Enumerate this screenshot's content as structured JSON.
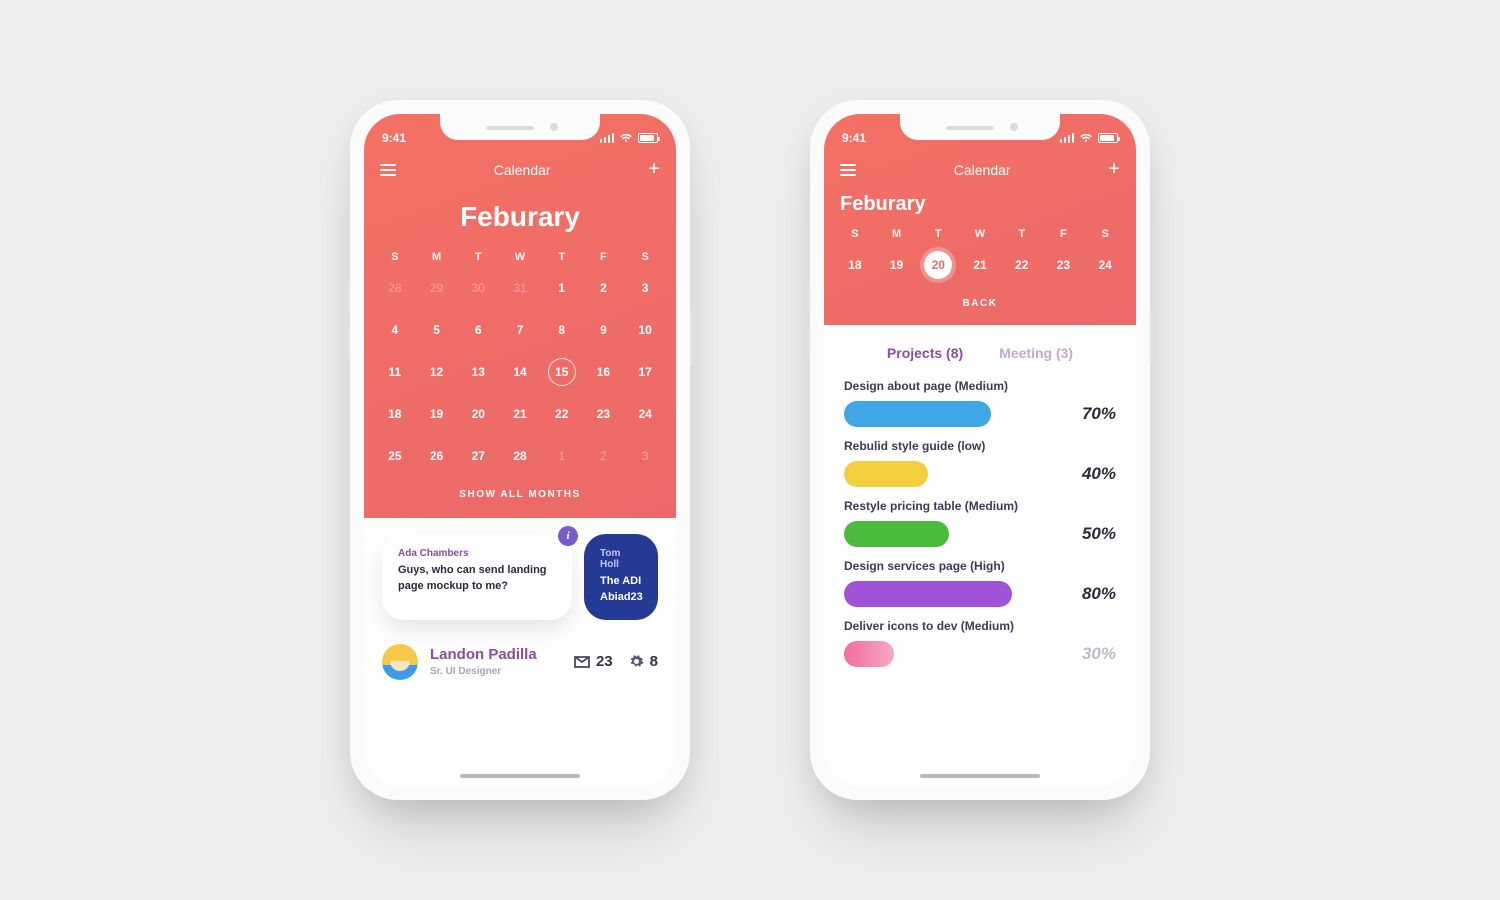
{
  "status": {
    "time": "9:41"
  },
  "header": {
    "title": "Calendar",
    "month": "Feburary",
    "show_all": "SHOW ALL MONTHS",
    "back": "BACK"
  },
  "dow": [
    "S",
    "M",
    "T",
    "W",
    "T",
    "F",
    "S"
  ],
  "month_grid": [
    [
      {
        "d": "28",
        "t": "prev"
      },
      {
        "d": "29",
        "t": "prev"
      },
      {
        "d": "30",
        "t": "prev"
      },
      {
        "d": "31",
        "t": "prev"
      },
      {
        "d": "1"
      },
      {
        "d": "2"
      },
      {
        "d": "3"
      }
    ],
    [
      {
        "d": "4"
      },
      {
        "d": "5"
      },
      {
        "d": "6"
      },
      {
        "d": "7"
      },
      {
        "d": "8"
      },
      {
        "d": "9"
      },
      {
        "d": "10"
      }
    ],
    [
      {
        "d": "11"
      },
      {
        "d": "12"
      },
      {
        "d": "13"
      },
      {
        "d": "14"
      },
      {
        "d": "15",
        "t": "sel"
      },
      {
        "d": "16"
      },
      {
        "d": "17"
      }
    ],
    [
      {
        "d": "18"
      },
      {
        "d": "19"
      },
      {
        "d": "20"
      },
      {
        "d": "21"
      },
      {
        "d": "22"
      },
      {
        "d": "23"
      },
      {
        "d": "24"
      }
    ],
    [
      {
        "d": "25"
      },
      {
        "d": "26"
      },
      {
        "d": "27"
      },
      {
        "d": "28"
      },
      {
        "d": "1",
        "t": "next"
      },
      {
        "d": "2",
        "t": "next"
      },
      {
        "d": "3",
        "t": "next"
      }
    ]
  ],
  "week_row": [
    {
      "d": "18"
    },
    {
      "d": "19"
    },
    {
      "d": "20",
      "t": "selsolid"
    },
    {
      "d": "21"
    },
    {
      "d": "22"
    },
    {
      "d": "23"
    },
    {
      "d": "24"
    }
  ],
  "cards": [
    {
      "author": "Ada Chambers",
      "msg": "Guys, who can send landing page mockup to me?",
      "variant": "white",
      "info": true
    },
    {
      "author": "Tom Holl",
      "msg": "The ADI Abiad23",
      "variant": "blue"
    }
  ],
  "user": {
    "name": "Landon Padilla",
    "role": "Sr. UI Designer",
    "mail": "23",
    "cfg": "8"
  },
  "tabs": [
    {
      "label": "Projects (8)",
      "active": true
    },
    {
      "label": "Meeting (3)",
      "active": false
    }
  ],
  "projects": [
    {
      "name": "Design about page (Medium)",
      "pct": "70%",
      "fill": 70,
      "color": "#3fa7e6"
    },
    {
      "name": "Rebulid style guide (low)",
      "pct": "40%",
      "fill": 40,
      "color": "#f3cf3e"
    },
    {
      "name": "Restyle pricing table (Medium)",
      "pct": "50%",
      "fill": 50,
      "color": "#4bbb3e"
    },
    {
      "name": "Design services page (High)",
      "pct": "80%",
      "fill": 80,
      "color": "#a053d6"
    },
    {
      "name": "Deliver icons to dev (Medium)",
      "pct": "30%",
      "fill": 24,
      "color": "linear-gradient(90deg,#f36ba0,#f7a8c2)",
      "dim": true
    }
  ]
}
